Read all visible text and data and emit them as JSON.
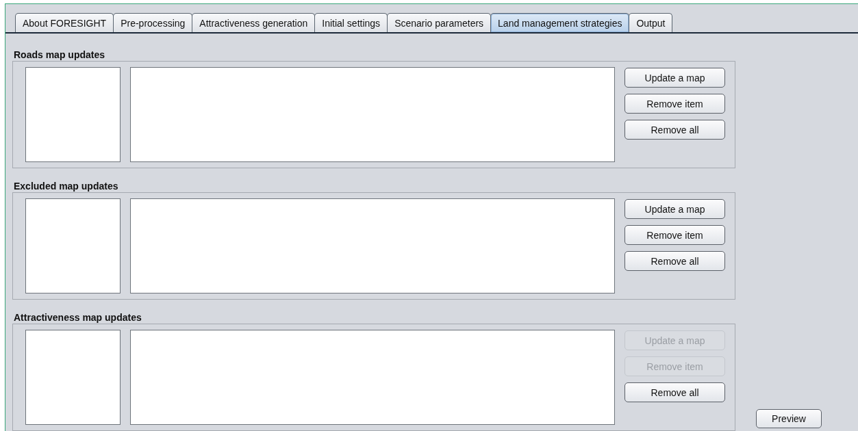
{
  "tabs": [
    {
      "label": "About FORESIGHT",
      "selected": false
    },
    {
      "label": "Pre-processing",
      "selected": false
    },
    {
      "label": "Attractiveness generation",
      "selected": false
    },
    {
      "label": "Initial settings",
      "selected": false
    },
    {
      "label": "Scenario parameters",
      "selected": false
    },
    {
      "label": "Land management strategies",
      "selected": true
    },
    {
      "label": "Output",
      "selected": false
    }
  ],
  "sections": [
    {
      "title": "Roads map updates",
      "buttons": [
        {
          "label": "Update a map",
          "disabled": false
        },
        {
          "label": "Remove item",
          "disabled": false
        },
        {
          "label": "Remove all",
          "disabled": false
        }
      ]
    },
    {
      "title": "Excluded map updates",
      "buttons": [
        {
          "label": "Update a map",
          "disabled": false
        },
        {
          "label": "Remove item",
          "disabled": false
        },
        {
          "label": "Remove all",
          "disabled": false
        }
      ]
    },
    {
      "title": "Attractiveness map updates",
      "buttons": [
        {
          "label": "Update a map",
          "disabled": true
        },
        {
          "label": "Remove item",
          "disabled": true
        },
        {
          "label": "Remove all",
          "disabled": false
        }
      ]
    }
  ],
  "preview_button": "Preview"
}
